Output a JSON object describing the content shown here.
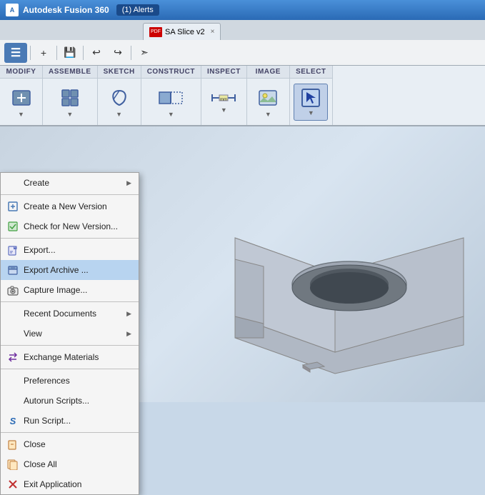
{
  "titleBar": {
    "appName": "Autodesk Fusion 360",
    "alerts": "(1) Alerts"
  },
  "tab": {
    "title": "SA Slice v2",
    "closeLabel": "×"
  },
  "ribbon": {
    "sections": [
      {
        "label": "MODIFY",
        "buttons": [
          {
            "icon": "↩",
            "label": ""
          }
        ]
      },
      {
        "label": "ASSEMBLE",
        "buttons": [
          {
            "icon": "⊞",
            "label": ""
          }
        ]
      },
      {
        "label": "SKETCH",
        "buttons": [
          {
            "icon": "↺",
            "label": ""
          }
        ]
      },
      {
        "label": "CONSTRUCT",
        "buttons": [
          {
            "icon": "◧",
            "label": ""
          }
        ]
      },
      {
        "label": "INSPECT",
        "buttons": [
          {
            "icon": "📏",
            "label": ""
          }
        ]
      },
      {
        "label": "IMAGE",
        "buttons": [
          {
            "icon": "🖼",
            "label": ""
          }
        ]
      },
      {
        "label": "SELECT",
        "buttons": [
          {
            "icon": "↖",
            "label": ""
          }
        ]
      }
    ]
  },
  "menu": {
    "sections": [
      {
        "items": [
          {
            "id": "create-header",
            "type": "header",
            "label": "Create",
            "hasSubmenu": true
          },
          {
            "id": "create-new-version",
            "type": "item",
            "label": "Create a New Version",
            "iconType": "new-version"
          },
          {
            "id": "check-new-version",
            "type": "item",
            "label": "Check for New Version...",
            "iconType": "check-version"
          },
          {
            "id": "export",
            "type": "item",
            "label": "Export...",
            "iconType": "export"
          },
          {
            "id": "export-archive",
            "type": "item",
            "label": "Export Archive ...",
            "iconType": "export-archive",
            "highlighted": true
          },
          {
            "id": "capture-image",
            "type": "item",
            "label": "Capture Image...",
            "iconType": "camera"
          }
        ]
      },
      {
        "items": [
          {
            "id": "recent-docs",
            "type": "item",
            "label": "Recent Documents",
            "hasSubmenu": true
          },
          {
            "id": "view",
            "type": "item",
            "label": "View",
            "hasSubmenu": true
          }
        ]
      },
      {
        "items": [
          {
            "id": "exchange-materials",
            "type": "item",
            "label": "Exchange Materials",
            "iconType": "exchange"
          }
        ]
      },
      {
        "items": [
          {
            "id": "preferences",
            "type": "item",
            "label": "Preferences"
          },
          {
            "id": "autorun-scripts",
            "type": "item",
            "label": "Autorun Scripts..."
          },
          {
            "id": "run-script",
            "type": "item",
            "label": "Run Script...",
            "iconType": "script"
          }
        ]
      },
      {
        "items": [
          {
            "id": "close",
            "type": "item",
            "label": "Close",
            "iconType": "close"
          },
          {
            "id": "close-all",
            "type": "item",
            "label": "Close All",
            "iconType": "close-all"
          },
          {
            "id": "exit-app",
            "type": "item",
            "label": "Exit Application",
            "iconType": "exit"
          }
        ]
      }
    ]
  },
  "toolbar": {
    "menuLabel": "≡",
    "buttons": [
      "+",
      "💾",
      "↩",
      "↪",
      "⇉"
    ]
  }
}
